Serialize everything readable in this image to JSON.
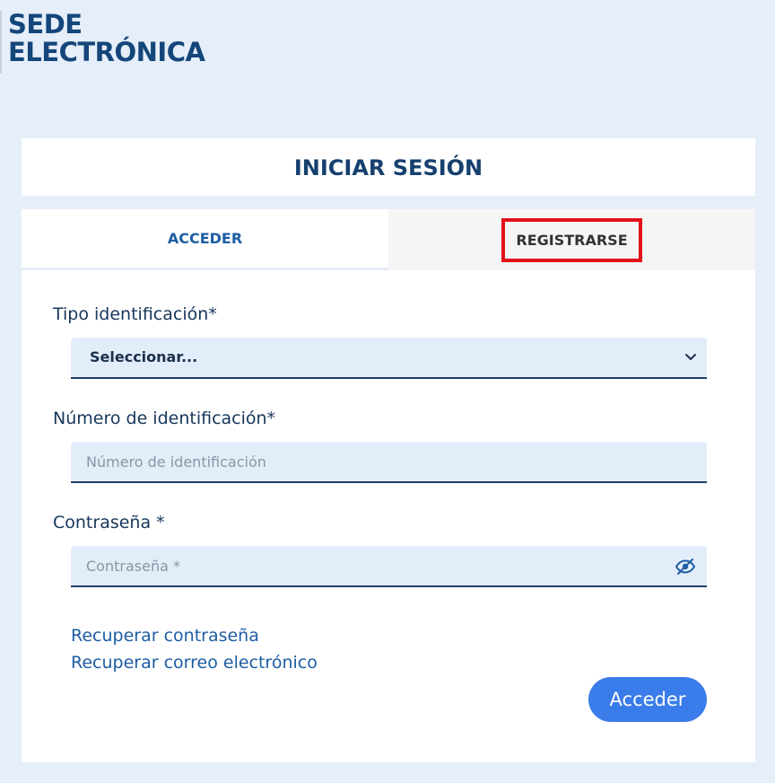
{
  "brand": {
    "line1": "SEDE",
    "line2": "ELECTRÓNICA",
    "color": "#14467a"
  },
  "card": {
    "title": "INICIAR SESIÓN"
  },
  "tabs": [
    {
      "label": "ACCEDER",
      "active": true
    },
    {
      "label": "REGISTRARSE",
      "active": false,
      "highlighted": true
    }
  ],
  "form": {
    "tipo": {
      "label": "Tipo identificación*",
      "value": "Seleccionar..."
    },
    "numero": {
      "label": "Número de identificación*",
      "placeholder": "Número de identificación"
    },
    "password": {
      "label": "Contraseña *",
      "placeholder": "Contraseña *",
      "icon": "eye-slash-icon"
    }
  },
  "links": {
    "recover_password": "Recuperar contraseña",
    "recover_email": "Recuperar correo electrónico"
  },
  "submit": {
    "label": "Acceder",
    "color": "#3a7ce9"
  },
  "colors": {
    "background": "#e5eef9",
    "highlight": "#e3111a",
    "accent": "#1d5da3"
  }
}
